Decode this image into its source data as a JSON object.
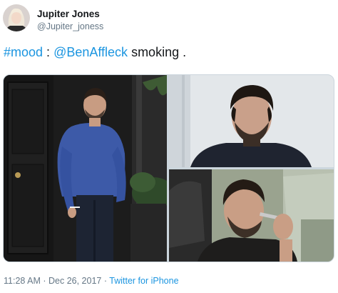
{
  "author": {
    "name": "Jupiter Jones",
    "handle": "@Jupiter_joness"
  },
  "tweet": {
    "hashtag": "#mood",
    "separator": " : ",
    "mention": "@BenAffleck",
    "text_after": " smoking ."
  },
  "media": {
    "photos": [
      "photo",
      "photo",
      "photo"
    ]
  },
  "meta": {
    "time": "11:28 AM",
    "dot1": " · ",
    "date": "Dec 26, 2017",
    "dot2": " · ",
    "source": "Twitter for iPhone"
  },
  "colors": {
    "link": "#1b95e0",
    "secondary_text": "#657786",
    "primary_text": "#14171a",
    "border": "#ccd6dd"
  }
}
